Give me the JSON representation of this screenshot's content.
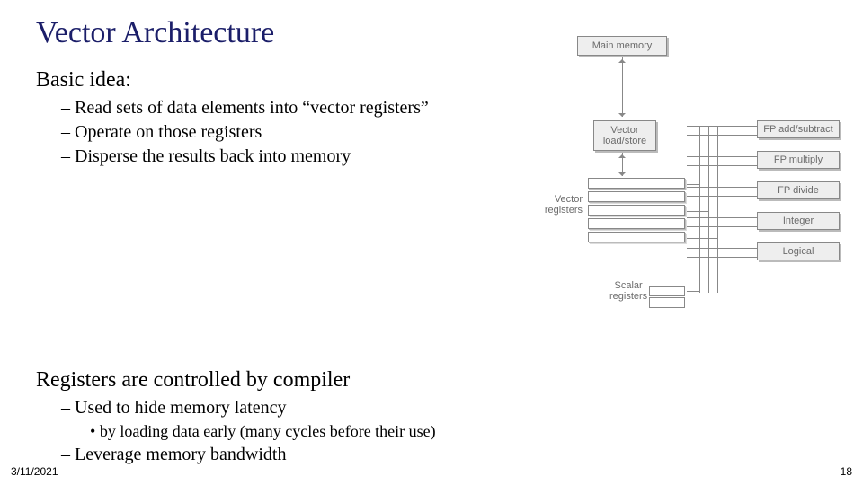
{
  "title": "Vector Architecture",
  "section1": {
    "heading": "Basic idea:",
    "items": [
      "Read sets of data elements into “vector registers”",
      "Operate on those registers",
      "Disperse the results back into memory"
    ]
  },
  "section2": {
    "heading": "Registers are controlled by compiler",
    "items": [
      {
        "text": "Used to hide memory latency",
        "sub": [
          "by loading data early (many cycles before their use)"
        ]
      },
      {
        "text": "Leverage memory bandwidth"
      }
    ]
  },
  "diagram": {
    "boxes": {
      "main_memory": "Main memory",
      "vector_load_store": "Vector\nload/store",
      "vector_registers": "Vector\nregisters",
      "scalar_registers": "Scalar\nregisters"
    },
    "func_units": [
      "FP add/subtract",
      "FP multiply",
      "FP divide",
      "Integer",
      "Logical"
    ]
  },
  "footer": {
    "date": "3/11/2021",
    "page": "18"
  }
}
